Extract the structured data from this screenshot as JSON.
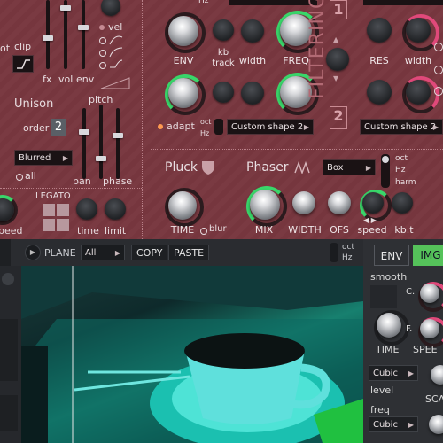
{
  "colors": {
    "panel": "#7a3a42",
    "accent_green": "#39d66a",
    "accent_pink": "#e0497a",
    "tab_active": "#55c25a"
  },
  "top": {
    "hz_label": "Hz",
    "clip": "clip",
    "fx": "fx",
    "vol": "vol",
    "env": "env",
    "vel": "vel",
    "unison": "Unison",
    "pitch": "pitch",
    "order": "order",
    "order_value": "2",
    "blur_mode": "Blurred",
    "all": "all",
    "pan": "pan",
    "phase": "phase",
    "legato": "LEGATO",
    "speed": "peed",
    "time": "time",
    "limit": "limit",
    "env_knob": "ENV",
    "kb_track": "kb\ntrack",
    "width": "width",
    "freq": "FREQ",
    "res": "RES",
    "width2": "width",
    "adapt": "adapt",
    "oct": "oct",
    "hz": "Hz",
    "shape1": "Custom shape 2",
    "shape2": "Custom shape 2",
    "num1": "1",
    "num2": "2",
    "section_label": "FILTERING SECTION",
    "pluck": "Pluck",
    "phaser": "Phaser",
    "phaser_mode": "Box",
    "oct2": "oct",
    "hz2": "Hz",
    "harm": "harm",
    "time_knob": "TIME",
    "blur": "blur",
    "mix": "MIX",
    "width3": "WIDTH",
    "ofs": "OFS",
    "speed2": "speed",
    "kbt": "kb.t"
  },
  "bar": {
    "plane_label": "PLANE",
    "plane_value": "All",
    "copy": "COPY",
    "paste": "PASTE",
    "oct": "oct",
    "hz": "Hz"
  },
  "right": {
    "tab_env": "ENV",
    "tab_img": "IMG",
    "smooth": "smooth",
    "c": "C.",
    "f": "F.",
    "time": "TIME",
    "speed": "SPEE",
    "interp1": "Cubic",
    "level": "level",
    "freq": "freq",
    "interp2": "Cubic",
    "sca": "SCA"
  }
}
